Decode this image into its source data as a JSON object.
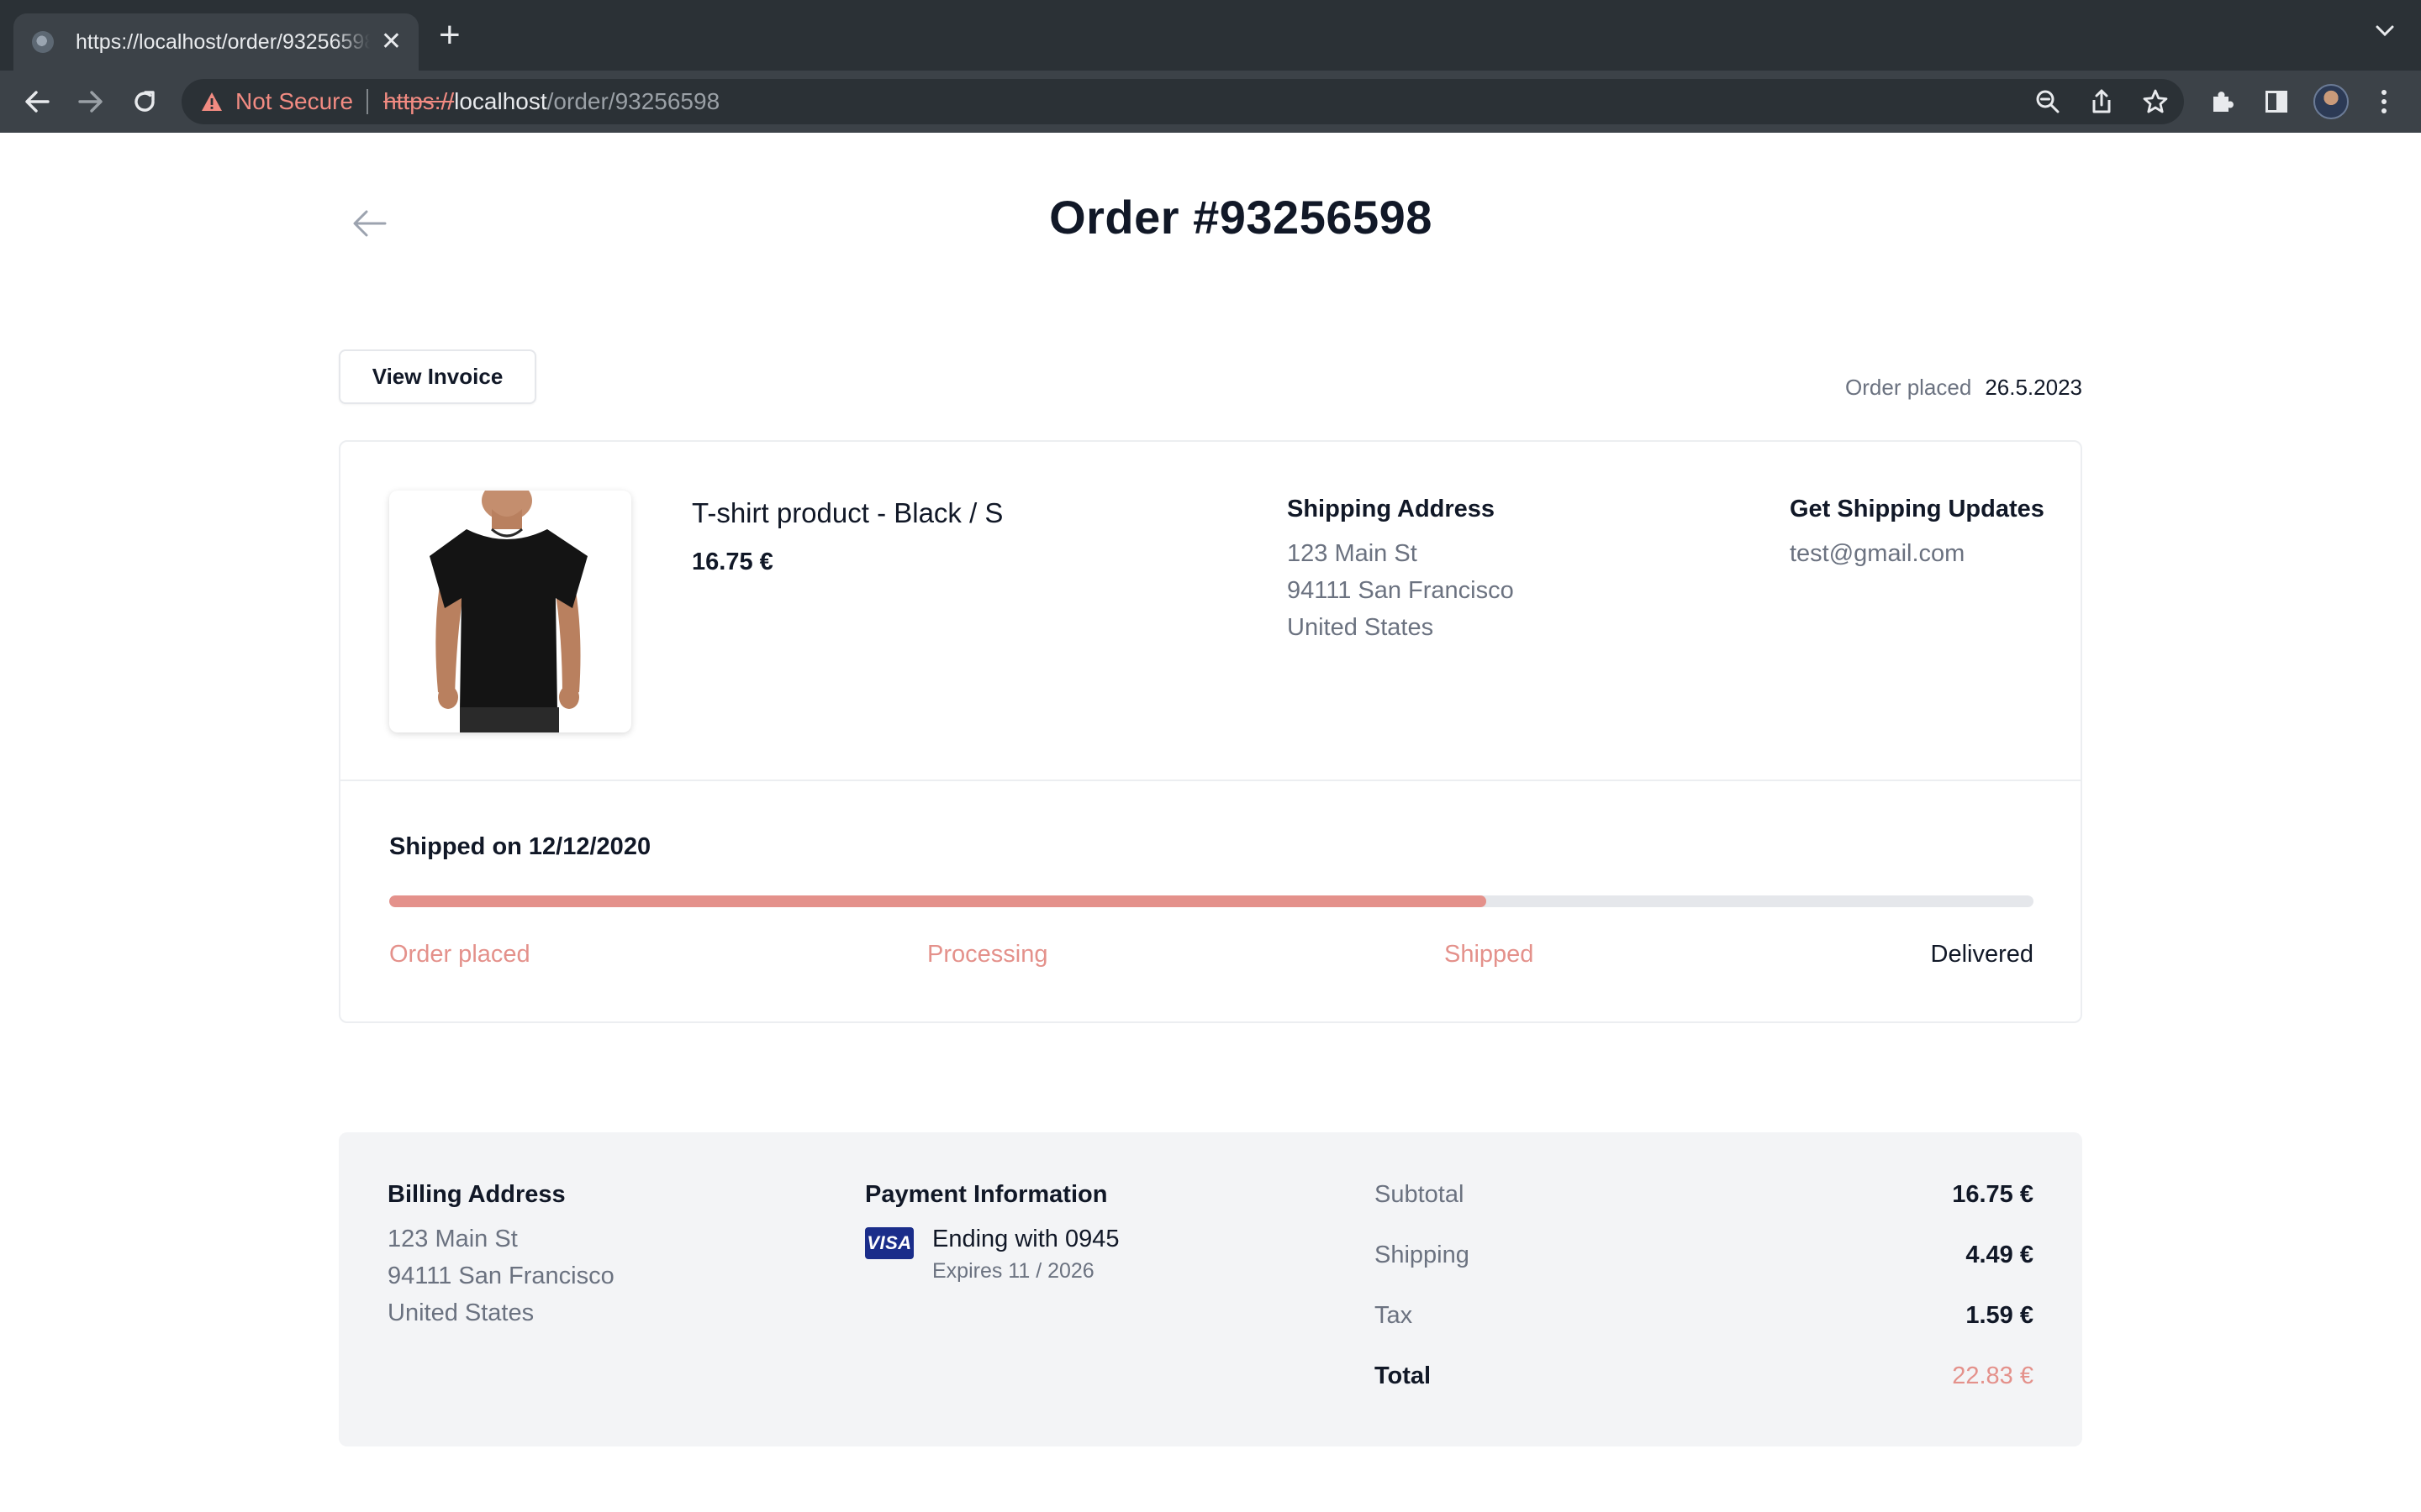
{
  "browser": {
    "tab_title": "https://localhost/order/93256598",
    "security_label": "Not Secure",
    "url_scheme": "https://",
    "url_host": "localhost",
    "url_path": "/order/93256598"
  },
  "page": {
    "title": "Order #93256598",
    "view_invoice_label": "View Invoice",
    "order_placed_label": "Order placed",
    "order_placed_date": "26.5.2023"
  },
  "product": {
    "name": "T-shirt product - Black / S",
    "price": "16.75 €",
    "image_icon": "black-tshirt-photo"
  },
  "shipping_address": {
    "heading": "Shipping Address",
    "line1": "123 Main St",
    "line2": "94111 San Francisco",
    "line3": "United States"
  },
  "shipping_updates": {
    "heading": "Get Shipping Updates",
    "email": "test@gmail.com"
  },
  "shipment": {
    "status_text": "Shipped on 12/12/2020",
    "progress_fraction": 0.667,
    "steps": [
      {
        "label": "Order placed",
        "done": true
      },
      {
        "label": "Processing",
        "done": true
      },
      {
        "label": "Shipped",
        "done": true
      },
      {
        "label": "Delivered",
        "done": false
      }
    ]
  },
  "billing_address": {
    "heading": "Billing Address",
    "line1": "123 Main St",
    "line2": "94111 San Francisco",
    "line3": "United States"
  },
  "payment": {
    "heading": "Payment Information",
    "card_brand": "VISA",
    "ending": "Ending with 0945",
    "expires": "Expires 11 / 2026"
  },
  "totals": {
    "subtotal_label": "Subtotal",
    "subtotal": "16.75 €",
    "shipping_label": "Shipping",
    "shipping": "4.49 €",
    "tax_label": "Tax",
    "tax": "1.59 €",
    "total_label": "Total",
    "total": "22.83 €"
  },
  "colors": {
    "accent": "#e4918b",
    "muted_text": "#6b7280",
    "summary_bg": "#f3f4f6"
  }
}
